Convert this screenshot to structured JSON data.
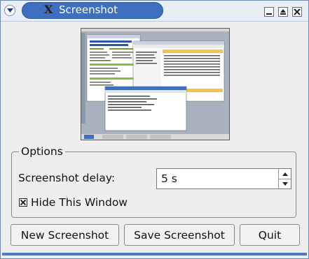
{
  "window": {
    "title": "Screenshot",
    "title_glyph": "X",
    "accent": "#3e70bf",
    "icons": [
      "menu-icon",
      "minimize-icon",
      "maximize-icon",
      "close-icon"
    ]
  },
  "options": {
    "group_label": "Options",
    "delay_label": "Screenshot delay:",
    "delay_value": "5 s",
    "hide_label": "Hide This Window",
    "hide_checked": true
  },
  "buttons": {
    "new": "New Screenshot",
    "save": "Save Screenshot",
    "quit": "Quit"
  }
}
